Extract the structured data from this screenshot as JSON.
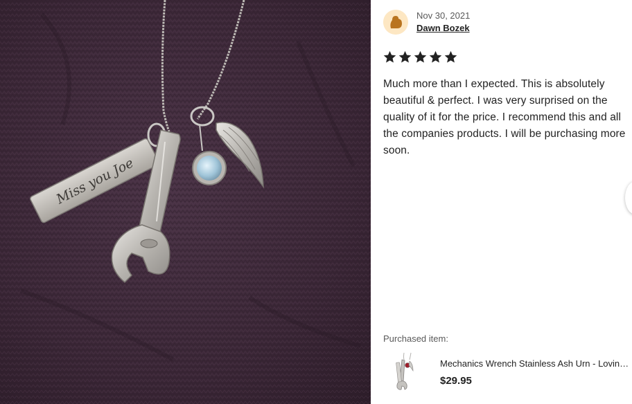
{
  "colors": {
    "sweater": "#3d2838",
    "silver": "#c9c7c4",
    "stars": "#222222",
    "avatar_bg": "#fde7c3",
    "avatar_fg": "#b9741f"
  },
  "photo": {
    "engraving": "Miss you Joe"
  },
  "review": {
    "avatar_icon": "user-avatar-icon",
    "date": "Nov 30, 2021",
    "reviewer": "Dawn Bozek",
    "rating": 5,
    "rating_max": 5,
    "text": "Much more than I expected. This is absolutely beautiful & perfect. I was very surprised on the quality of it for the price. I recommend this and all the companies products. I will be purchasing more soon."
  },
  "purchased": {
    "label": "Purchased item:",
    "title": "Mechanics Wrench Stainless Ash Urn - Loving Memory Jewelry",
    "price": "$29.95"
  }
}
